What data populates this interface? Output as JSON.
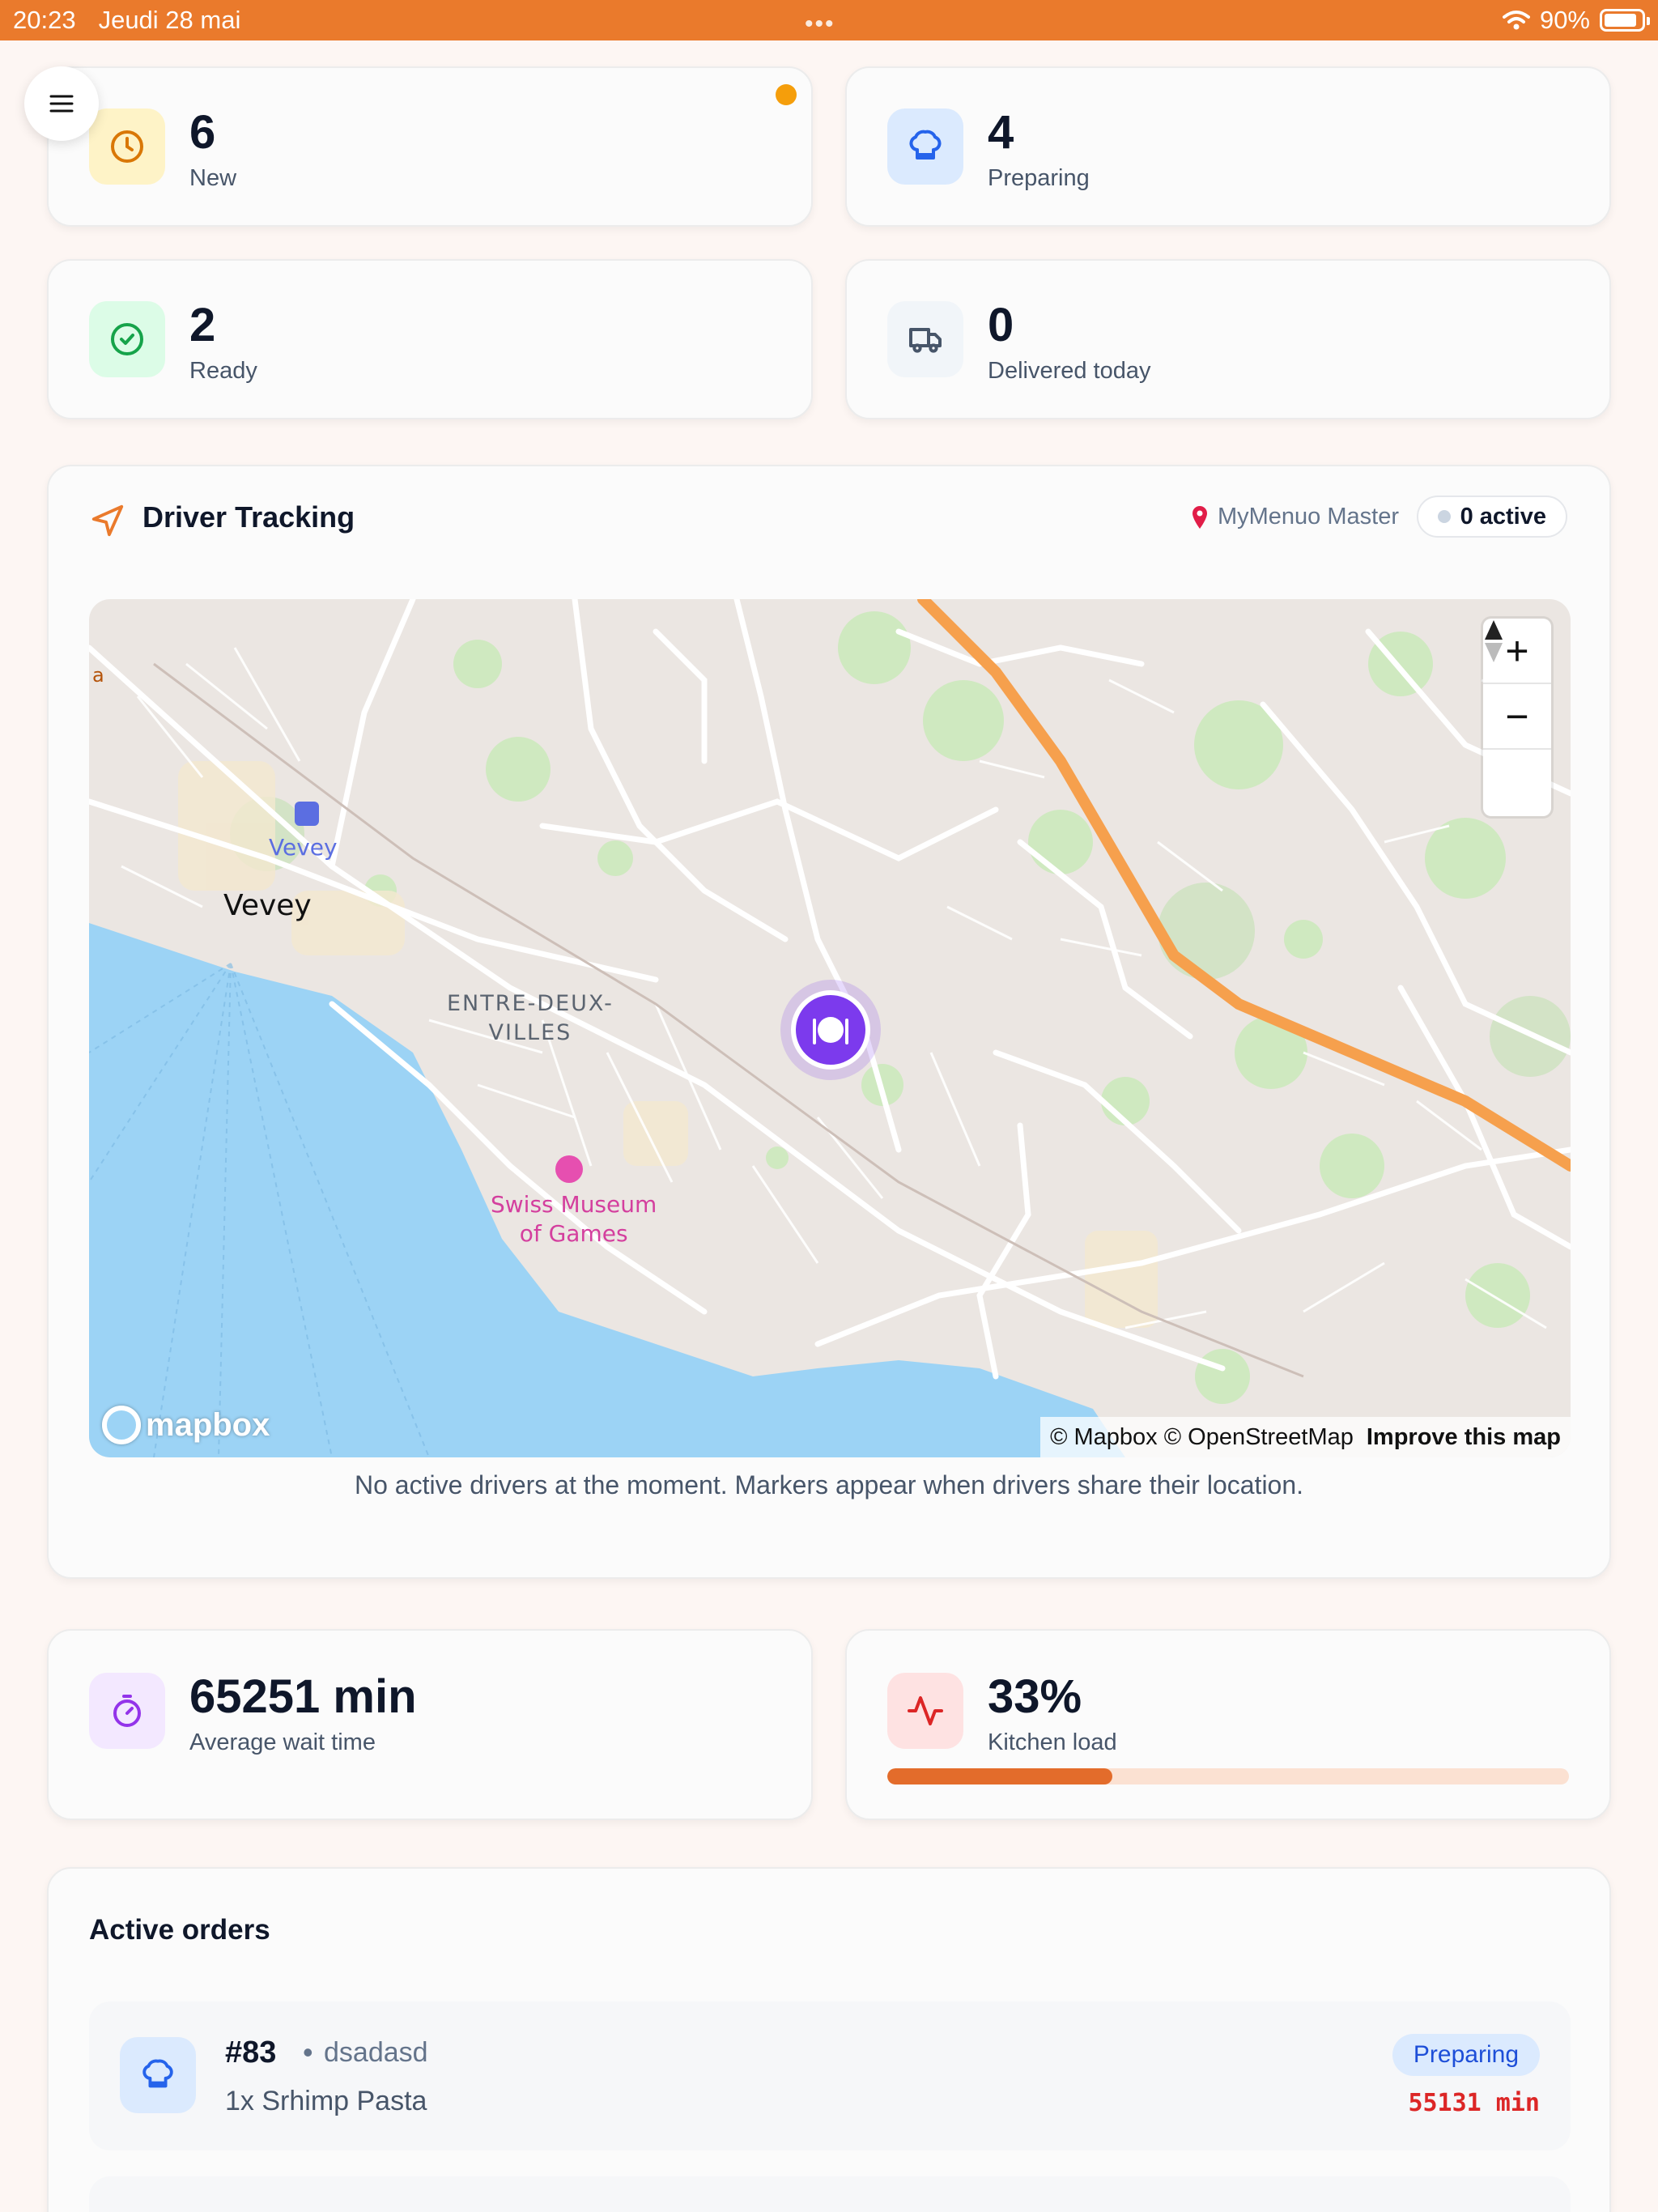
{
  "status_bar": {
    "time": "20:23",
    "date": "Jeudi 28 mai",
    "battery": "90%"
  },
  "stats": [
    {
      "value": "6",
      "label": "New",
      "icon": "clock-icon",
      "color": "#d97706",
      "bg": "#fef3c7"
    },
    {
      "value": "4",
      "label": "Preparing",
      "icon": "chef-hat-icon",
      "color": "#2563eb",
      "bg": "#dbeafe"
    },
    {
      "value": "2",
      "label": "Ready",
      "icon": "check-circle-icon",
      "color": "#16a34a",
      "bg": "#dcfce7"
    },
    {
      "value": "0",
      "label": "Delivered today",
      "icon": "truck-icon",
      "color": "#475569",
      "bg": "#f1f5f9"
    }
  ],
  "driver_tracking": {
    "title": "Driver Tracking",
    "location": "MyMenuo Master",
    "active_badge": "0 active",
    "empty_message": "No active drivers at the moment. Markers appear when drivers share their location.",
    "map": {
      "labels": {
        "vevey_station": "Vevey",
        "vevey_city": "Vevey",
        "district_line1": "ENTRE-DEUX-",
        "district_line2": "VILLES",
        "museum_line1": "Swiss Museum",
        "museum_line2": "of Games",
        "edge": "a"
      },
      "logo": "mapbox",
      "attribution": "© Mapbox © OpenStreetMap",
      "improve_link": "Improve this map",
      "zoom_in": "+",
      "zoom_out": "−"
    }
  },
  "metrics": [
    {
      "value": "65251 min",
      "label": "Average wait time",
      "icon": "timer-icon",
      "color": "#9333ea",
      "bg": "#f3e8ff"
    },
    {
      "value": "33%",
      "label": "Kitchen load",
      "icon": "activity-icon",
      "color": "#dc2626",
      "bg": "#fee2e2",
      "load_fraction": 0.33
    }
  ],
  "active_orders": {
    "title": "Active orders",
    "orders": [
      {
        "number": "#83",
        "separator": "•",
        "customer": "dsadasd",
        "items": "1x Srhimp Pasta",
        "status": "Preparing",
        "elapsed": "55131 min"
      }
    ]
  },
  "colors": {
    "accent": "#ea7a2c",
    "status_preparing": "#1d4ed8",
    "elapsed_alert": "#dc2626",
    "restaurant_marker": "#7c3aed"
  }
}
